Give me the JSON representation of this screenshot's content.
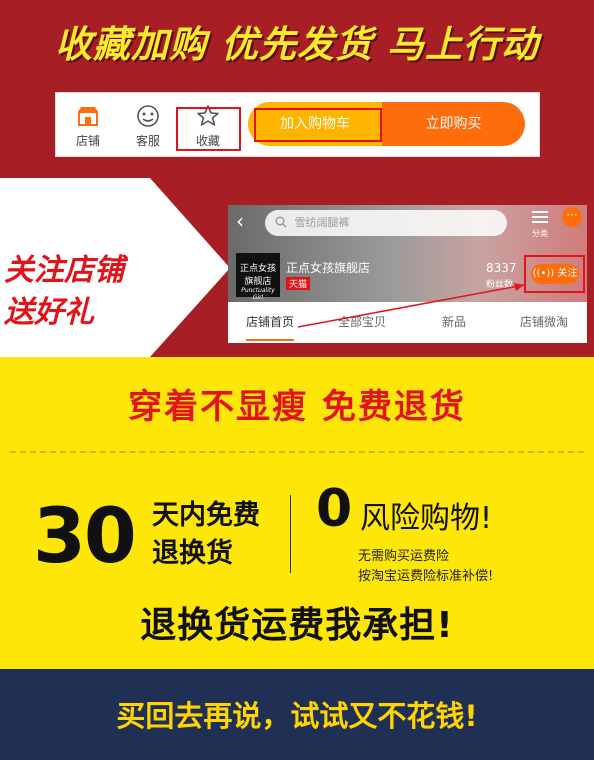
{
  "section1": {
    "headline": "收藏加购 优先发货 马上行动",
    "bar": {
      "shop": "店铺",
      "service": "客服",
      "favorite": "收藏",
      "add_cart": "加入购物车",
      "buy_now": "立即购买"
    }
  },
  "section2": {
    "slogan_line1": "关注店铺",
    "slogan_line2": "送好礼",
    "phone": {
      "search_placeholder": "雪纺阔腿裤",
      "category": "分类",
      "shop_name": "正点女孩旗舰店",
      "tmall_badge": "天猫",
      "fans_count": "8337",
      "fans_label": "粉丝数",
      "follow": "关注",
      "logo_script": "Punctuality Girl",
      "tabs": [
        "店铺首页",
        "全部宝贝",
        "新品",
        "店铺微淘"
      ]
    }
  },
  "section3": {
    "headline": "穿着不显瘦 免费退货"
  },
  "section4": {
    "days_number": "30",
    "days_line1": "天内免费",
    "days_line2": "退换货",
    "zero_number": "0",
    "zero_text": "风险购物!",
    "note_line1": "无需购买运费险",
    "note_line2": "按淘宝运费险标准补偿!",
    "shipping": "退换货运费我承担!"
  },
  "section5": {
    "headline": "买回去再说，试试又不花钱!"
  },
  "colors": {
    "red_bg": "#a71f24",
    "yellow_bg": "#ffe609",
    "navy_bg": "#1f3054",
    "accent_red": "#e1141b",
    "orange": "#ff6c0c"
  }
}
